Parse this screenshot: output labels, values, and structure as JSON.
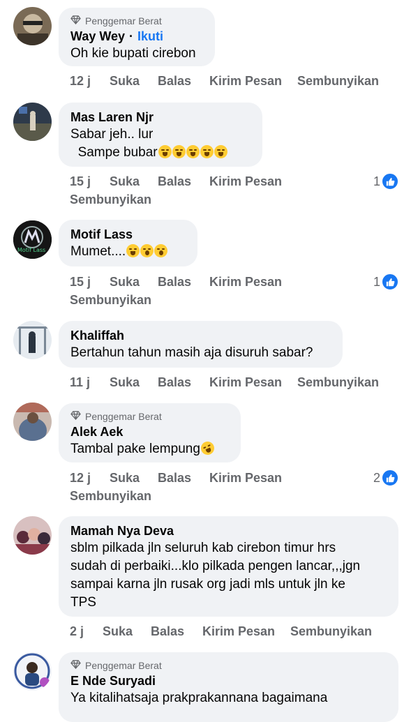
{
  "badge_label": "Penggemar Berat",
  "actions": {
    "like": "Suka",
    "reply": "Balas",
    "message": "Kirim Pesan",
    "hide": "Sembunyikan"
  },
  "comments": [
    {
      "name": "Way Wey",
      "follow": "Ikuti",
      "text": "Oh kie bupati cirebon",
      "time": "12 j"
    },
    {
      "name": "Mas Laren Njr",
      "text_line1": "Sabar jeh.. lur",
      "text_line2": "  Sampe bubar",
      "time": "15 j",
      "reactions": "1"
    },
    {
      "name": "Motif Lass",
      "avatar_text": "Motif Lass",
      "text": "Mumet....",
      "time": "15 j",
      "reactions": "1"
    },
    {
      "name": "Khaliffah",
      "text": "Bertahun tahun masih aja disuruh sabar?",
      "time": "11 j"
    },
    {
      "name": "Alek Aek",
      "text": "Tambal pake lempung",
      "time": "12 j",
      "reactions": "2"
    },
    {
      "name": "Mamah Nya Deva",
      "text_lines": [
        "sblm pilkada jln seluruh kab cirebon timur hrs",
        "sudah di perbaiki...klo pilkada pengen lancar,,,jgn",
        "sampai karna jln rusak org jadi mls untuk jln ke",
        "TPS"
      ],
      "time": "2 j"
    },
    {
      "name": "E Nde Suryadi",
      "text": "Ya kitalihatsaja prakprakannana bagaimana"
    }
  ],
  "colors": {
    "bubble": "#f0f2f5",
    "meta": "#65676b",
    "link": "#1877f2",
    "like": "#1877f2"
  }
}
